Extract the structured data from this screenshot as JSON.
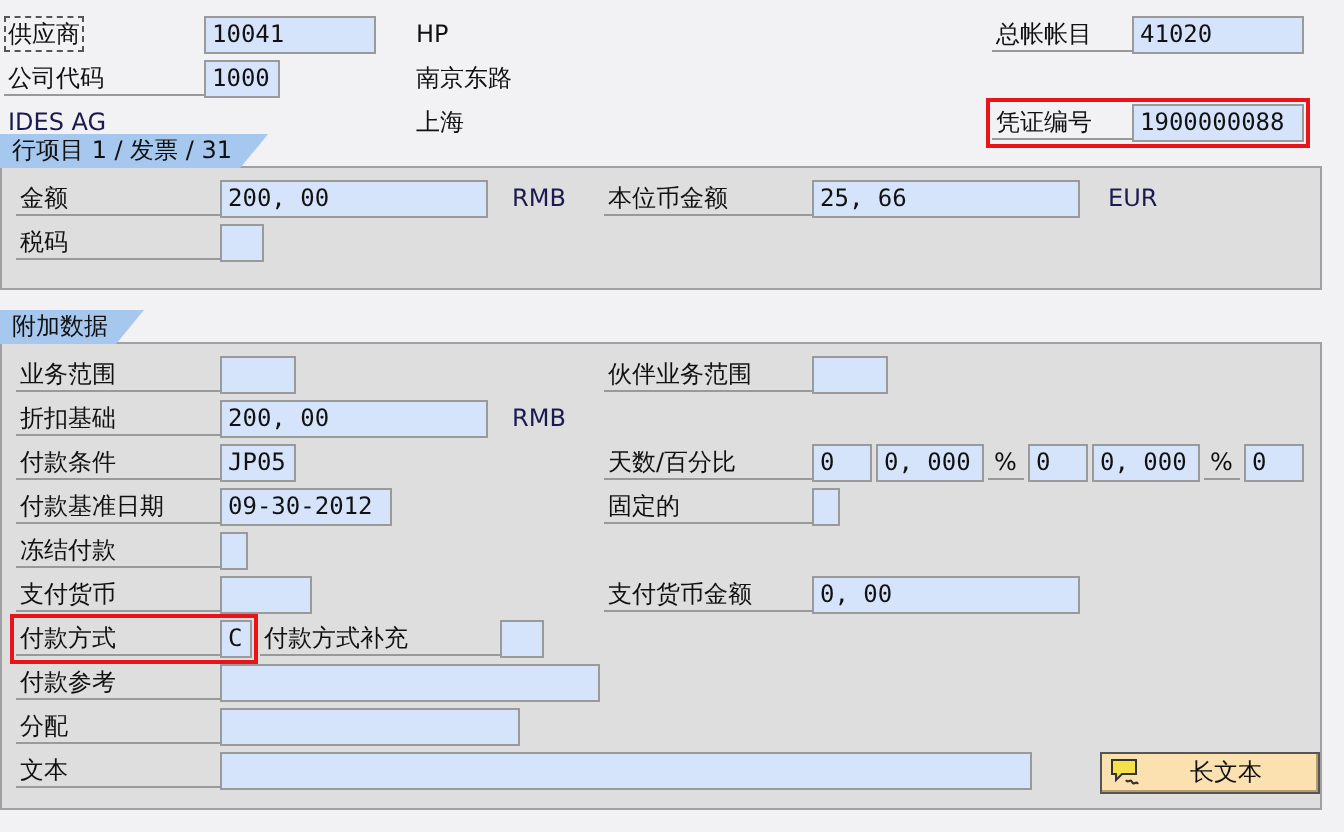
{
  "header": {
    "rows": [
      {
        "left": [
          {
            "kind": "label",
            "text": "供应商",
            "focused": true
          },
          {
            "kind": "field",
            "value": "10041"
          }
        ],
        "text": "HP",
        "right": [
          {
            "kind": "label",
            "text": "总帐帐目"
          },
          {
            "kind": "field",
            "value": "41020"
          }
        ]
      },
      {
        "left": [
          {
            "kind": "label",
            "text": "公司代码"
          },
          {
            "kind": "field",
            "value": "1000"
          }
        ],
        "text": "南京东路",
        "right": []
      },
      {
        "left": [
          {
            "kind": "text",
            "text": "IDES AG"
          }
        ],
        "text": "上海",
        "right": [
          {
            "kind": "label",
            "text": "凭证编号",
            "highlighted": true
          },
          {
            "kind": "field",
            "value": "1900000088"
          }
        ]
      }
    ]
  },
  "sections": [
    {
      "title": "行项目 1 / 发票 / 31",
      "rows": [
        {
          "left": [
            {
              "kind": "label",
              "text": "金额"
            },
            {
              "kind": "field",
              "value": "200, 00"
            },
            {
              "kind": "text",
              "text": "RMB"
            }
          ],
          "right": [
            {
              "kind": "label",
              "text": "本位币金额"
            },
            {
              "kind": "field",
              "value": "25, 66"
            },
            {
              "kind": "text",
              "text": "EUR"
            }
          ]
        },
        {
          "left": [
            {
              "kind": "label",
              "text": "税码"
            },
            {
              "kind": "field"
            }
          ],
          "right": []
        }
      ]
    },
    {
      "title": "附加数据",
      "rows": [
        {
          "left": [
            {
              "kind": "label",
              "text": "业务范围"
            },
            {
              "kind": "field"
            }
          ],
          "right": [
            {
              "kind": "label",
              "text": "伙伴业务范围"
            },
            {
              "kind": "field"
            }
          ]
        },
        {
          "left": [
            {
              "kind": "label",
              "text": "折扣基础"
            },
            {
              "kind": "field",
              "value": "200, 00"
            },
            {
              "kind": "text",
              "text": "RMB"
            }
          ],
          "right": []
        },
        {
          "left": [
            {
              "kind": "label",
              "text": "付款条件"
            },
            {
              "kind": "field",
              "value": "JP05"
            }
          ],
          "right": [
            {
              "kind": "label",
              "text": "天数/百分比"
            },
            {
              "kind": "field",
              "value": "0"
            },
            {
              "kind": "field",
              "value": "0, 000"
            },
            {
              "kind": "unit",
              "text": "%"
            },
            {
              "kind": "field",
              "value": "0"
            },
            {
              "kind": "field",
              "value": "0, 000"
            },
            {
              "kind": "unit",
              "text": "%"
            },
            {
              "kind": "field",
              "value": "0"
            }
          ]
        },
        {
          "left": [
            {
              "kind": "label",
              "text": "付款基准日期"
            },
            {
              "kind": "field",
              "value": "09-30-2012"
            }
          ],
          "right": [
            {
              "kind": "label",
              "text": "固定的"
            },
            {
              "kind": "field"
            }
          ]
        },
        {
          "left": [
            {
              "kind": "label",
              "text": "冻结付款"
            },
            {
              "kind": "field"
            }
          ],
          "right": []
        },
        {
          "left": [
            {
              "kind": "label",
              "text": "支付货币"
            },
            {
              "kind": "field"
            }
          ],
          "right": [
            {
              "kind": "label",
              "text": "支付货币金额"
            },
            {
              "kind": "field",
              "value": "0, 00"
            }
          ]
        },
        {
          "left": [
            {
              "kind": "label",
              "text": "付款方式",
              "highlighted": true
            },
            {
              "kind": "field",
              "value": "C"
            },
            {
              "kind": "sublabel",
              "text": "付款方式补充"
            },
            {
              "kind": "field"
            }
          ],
          "right": []
        },
        {
          "left": [
            {
              "kind": "label",
              "text": "付款参考"
            },
            {
              "kind": "field"
            }
          ],
          "right": []
        },
        {
          "left": [
            {
              "kind": "label",
              "text": "分配"
            },
            {
              "kind": "field"
            }
          ],
          "right": []
        },
        {
          "left": [
            {
              "kind": "label",
              "text": "文本"
            },
            {
              "kind": "field"
            }
          ],
          "right": [
            {
              "kind": "button",
              "text": "长文本"
            }
          ]
        }
      ]
    }
  ]
}
